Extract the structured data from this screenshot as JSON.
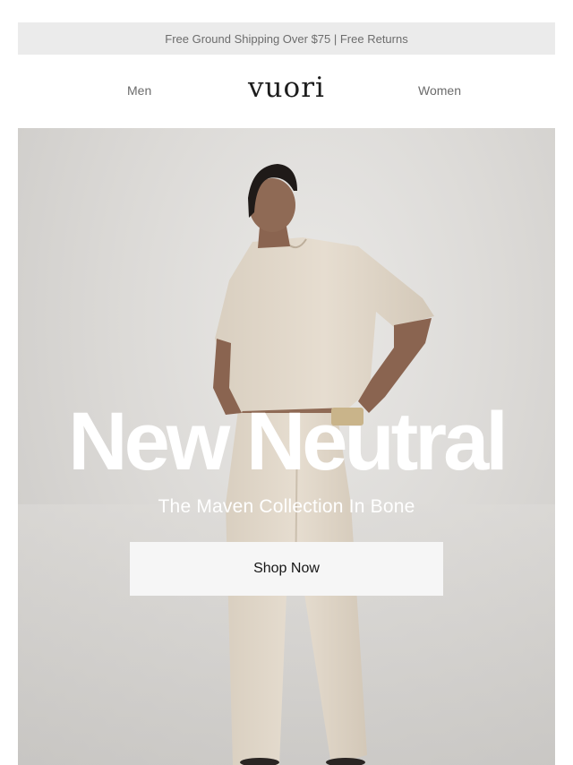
{
  "announcement": {
    "text": "Free Ground Shipping Over $75 | Free Returns"
  },
  "nav": {
    "left_link": "Men",
    "logo": "vuori",
    "right_link": "Women"
  },
  "hero": {
    "headline": "New Neutral",
    "subheadline": "The Maven Collection In Bone",
    "cta_label": "Shop Now",
    "image": "model-in-bone-tee-and-trousers"
  },
  "colors": {
    "announcement_bg": "#ebebeb",
    "hero_bg": "#dcdad7",
    "outfit": "#e2d9cb",
    "cta_bg": "#f6f6f6"
  }
}
